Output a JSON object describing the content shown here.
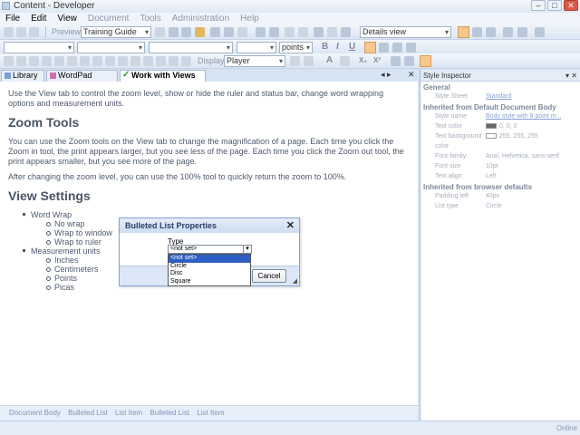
{
  "window": {
    "title": "Content - Developer",
    "buttons": [
      "–",
      "□",
      "✕"
    ]
  },
  "menu": [
    {
      "label": "File",
      "enabled": true
    },
    {
      "label": "Edit",
      "enabled": true
    },
    {
      "label": "View",
      "enabled": true
    },
    {
      "label": "Document",
      "enabled": false
    },
    {
      "label": "Tools",
      "enabled": false
    },
    {
      "label": "Administration",
      "enabled": false
    },
    {
      "label": "Help",
      "enabled": false
    }
  ],
  "toolbar": {
    "preview_label": "Preview",
    "stylesheet_value": "Training Guide",
    "view_value": "Details view",
    "units_value": "points",
    "bold": "B",
    "italic": "I",
    "underline": "U",
    "display_label": "Display:",
    "display_value": "Player",
    "font_color": "A",
    "subscript": "X₂",
    "superscript": "X²"
  },
  "tabs": [
    {
      "label": "Library",
      "active": false,
      "icon": "library-icon"
    },
    {
      "label": "WordPad Training",
      "active": false,
      "icon": "document-icon"
    },
    {
      "label": "Work with Views",
      "active": true,
      "icon": "checkmark-icon"
    }
  ],
  "pane_controls": {
    "nav": "◂ ▸",
    "close": "✕"
  },
  "document": {
    "intro": "Use the View tab to control the zoom level, show or hide the ruler and status bar, change word wrapping options and measurement units.",
    "heading1": "Zoom Tools",
    "para1": "You can use the Zoom tools on the View tab to change the magnification of a page. Each time you click the Zoom in tool, the print appears larger, but you see less of the page. Each time you click the Zoom out tool, the print appears smaller, but you see more of the page.",
    "para2": "After changing the zoom level, you can use the 100% tool to quickly return the zoom to 100%.",
    "heading2": "View Settings",
    "list": [
      {
        "label": "Word Wrap",
        "children": [
          "No wrap",
          "Wrap to window",
          "Wrap to ruler"
        ]
      },
      {
        "label": "Measurement units",
        "children": [
          "Inches",
          "Centimeters",
          "Points",
          "Picas"
        ]
      }
    ]
  },
  "tagbar": [
    "Document Body",
    "Bulleted List",
    "List Item",
    "Bulleted List",
    "List Item"
  ],
  "inspector": {
    "title": "Style Inspector",
    "controls": "▾ ✕",
    "sections": [
      {
        "title": "General",
        "rows": [
          {
            "key": "Style Sheet",
            "value": "Standard",
            "link": true
          }
        ]
      },
      {
        "title": "Inherited from Default Document Body",
        "rows": [
          {
            "key": "Style name",
            "value": "Body style with 8 point m...",
            "link": true
          },
          {
            "key": "Text color",
            "value": "0, 0, 0",
            "swatch": "#666666"
          },
          {
            "key": "Text background color",
            "value": "255, 255, 255",
            "swatch": "#ffffff"
          },
          {
            "key": "Font family",
            "value": "Arial, Helvetica, sans-serif"
          },
          {
            "key": "Font size",
            "value": "10pt"
          },
          {
            "key": "Text align",
            "value": "Left"
          }
        ]
      },
      {
        "title": "Inherited from browser defaults",
        "rows": [
          {
            "key": "Padding left",
            "value": "40px"
          },
          {
            "key": "List type",
            "value": "Circle"
          }
        ]
      }
    ]
  },
  "status": {
    "text": "Online"
  },
  "dialog": {
    "title": "Bulleted List Properties",
    "close": "✕",
    "type_label": "Type",
    "type_value": "<not set>",
    "options": [
      "<not set>",
      "Circle",
      "Disc",
      "Square"
    ],
    "highlighted_index": 0,
    "cancel_label": "Cancel",
    "resize_grip": "◢"
  },
  "colors": {
    "accent": "#2e5fc4",
    "chrome": "#d6e3f3"
  }
}
